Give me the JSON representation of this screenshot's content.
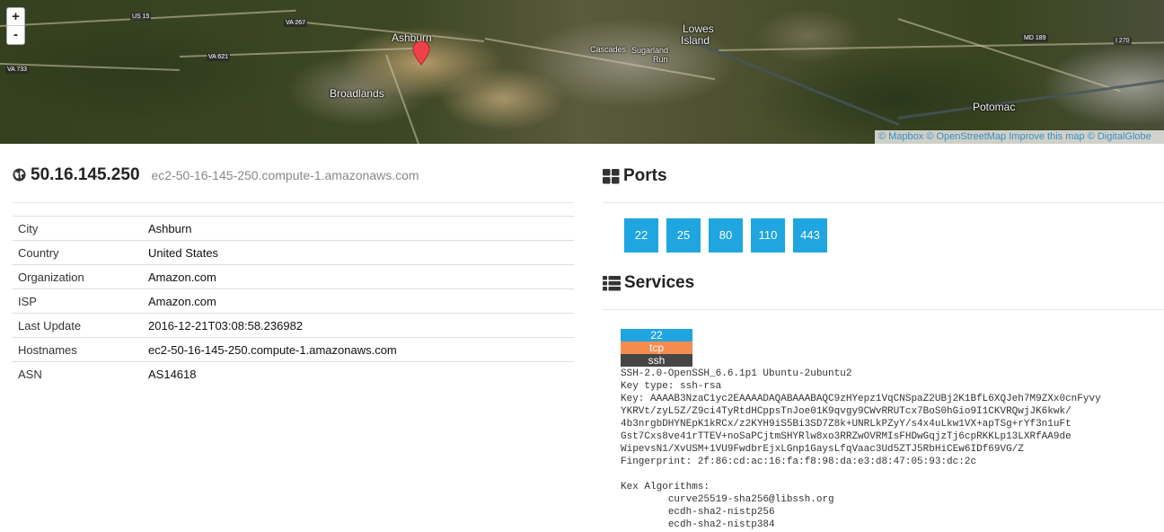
{
  "map": {
    "zoom_in": "+",
    "zoom_out": "-",
    "labels": {
      "ashburn": "Ashburn",
      "broadlands": "Broadlands",
      "lowes_island_1": "Lowes",
      "lowes_island_2": "Island",
      "cascades": "Cascades",
      "sugarland_1": "Sugarland",
      "sugarland_2": "Run",
      "potomac": "Potomac",
      "us15": "US 15",
      "va267": "VA 267",
      "va733": "VA 733",
      "va621": "VA 621",
      "md189": "MD 189",
      "i270": "I 270"
    },
    "attribution": {
      "mapbox": "© Mapbox",
      "osm": "© OpenStreetMap",
      "improve": "Improve this map",
      "digitalglobe": "© DigitalGlobe"
    }
  },
  "host": {
    "ip": "50.16.145.250",
    "hostname": "ec2-50-16-145-250.compute-1.amazonaws.com"
  },
  "info": [
    {
      "key": "City",
      "value": "Ashburn"
    },
    {
      "key": "Country",
      "value": "United States"
    },
    {
      "key": "Organization",
      "value": "Amazon.com"
    },
    {
      "key": "ISP",
      "value": "Amazon.com"
    },
    {
      "key": "Last Update",
      "value": "2016-12-21T03:08:58.236982"
    },
    {
      "key": "Hostnames",
      "value": "ec2-50-16-145-250.compute-1.amazonaws.com"
    },
    {
      "key": "ASN",
      "value": "AS14618"
    }
  ],
  "ports_section": {
    "title": "Ports",
    "ports": [
      "22",
      "25",
      "80",
      "110",
      "443"
    ]
  },
  "services_section": {
    "title": "Services",
    "service": {
      "port": "22",
      "protocol": "tcp",
      "name": "ssh",
      "banner": "SSH-2.0-OpenSSH_6.6.1p1 Ubuntu-2ubuntu2\nKey type: ssh-rsa\nKey: AAAAB3NzaC1yc2EAAAADAQABAAABAQC9zHYepz1VqCNSpaZ2UBj2K1BfL6XQJeh7M9ZXx0cnFyvy\nYKRVt/zyL5Z/Z9ci4TyRtdHCppsTnJoe01K9qvgy9CWvRRUTcx7BoS0hGio9I1CKVRQwjJK6kwk/\n4b3nrgbDHYNEpK1kRCx/z2KYH9iS5Bi3SD7Z8k+UNRLkPZyY/s4x4uLkw1VX+apTSg+rYf3n1uFt\nGst7Cxs8ve41rTTEV+noSaPCjtmSHYRlw8xo3RRZwOVRMIsFHDwGqjzTj6cpRKKLp13LXRfAA9de\nWipevsN1/XvUSM+1VU9FwdbrEjxLGnp1GaysLfqVaac3Ud5ZTJ5RbHiCEw6IDf69VG/Z\nFingerprint: 2f:86:cd:ac:16:fa:f8:98:da:e3:d8:47:05:93:dc:2c\n\nKex Algorithms:\n\tcurve25519-sha256@libssh.org\n\tecdh-sha2-nistp256\n\tecdh-sha2-nistp384"
    }
  }
}
